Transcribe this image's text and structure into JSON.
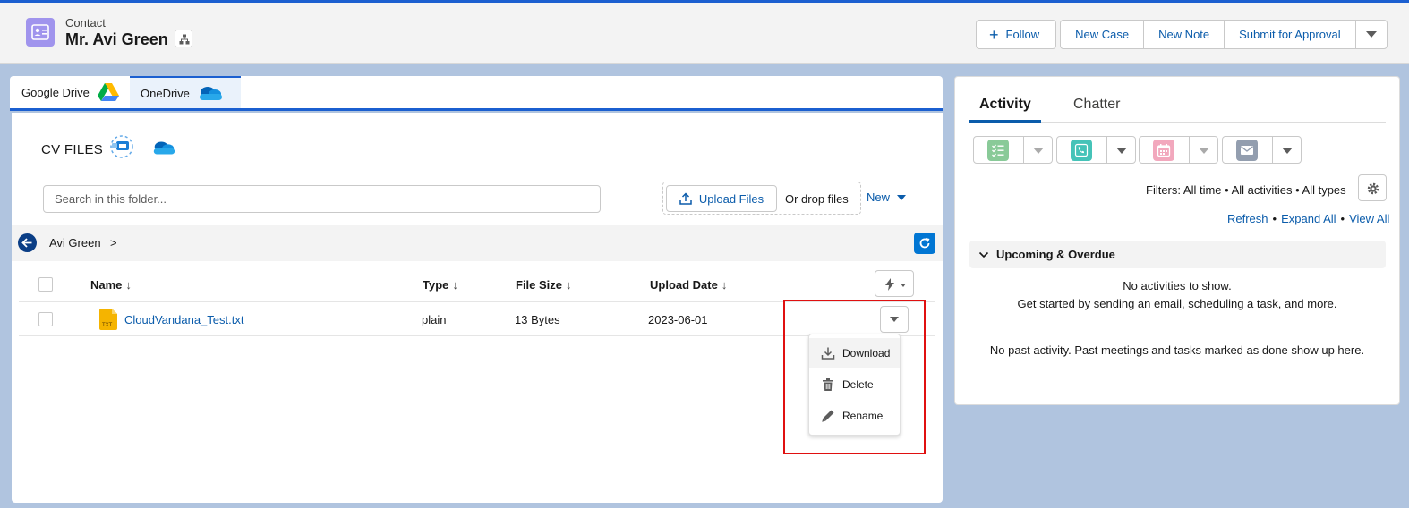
{
  "header": {
    "object_type": "Contact",
    "record_name": "Mr. Avi Green",
    "buttons": {
      "follow": "Follow",
      "new_case": "New Case",
      "new_note": "New Note",
      "submit": "Submit for Approval"
    }
  },
  "storage_tabs": [
    {
      "label": "Google Drive",
      "icon": "google-drive-icon"
    },
    {
      "label": "OneDrive",
      "icon": "onedrive-icon",
      "active": true
    }
  ],
  "files": {
    "title": "CV FILES",
    "search_placeholder": "Search in this folder...",
    "upload_label": "Upload Files",
    "drop_label": "Or drop files",
    "new_label": "New",
    "breadcrumb": {
      "folder": "Avi Green",
      "separator": ">"
    },
    "columns": {
      "name": "Name",
      "type": "Type",
      "size": "File Size",
      "date": "Upload Date",
      "sort_arrow": "↓"
    },
    "rows": [
      {
        "name": "CloudVandana_Test.txt",
        "type": "plain",
        "size": "13 Bytes",
        "date": "2023-06-01",
        "icon": "txt-file-icon"
      }
    ],
    "file_icon_label": "TXT",
    "row_menu": {
      "download": "Download",
      "delete": "Delete",
      "rename": "Rename"
    }
  },
  "activity": {
    "tabs": {
      "activity": "Activity",
      "chatter": "Chatter"
    },
    "action_colors": {
      "task": "#3ba755",
      "call": "#45c3b8",
      "event": "#eb7092",
      "email": "#939eaf"
    },
    "filters": "Filters: All time • All activities • All types",
    "links": {
      "refresh": "Refresh",
      "expand": "Expand All",
      "view": "View All",
      "dot": "•"
    },
    "section": "Upcoming & Overdue",
    "empty_line1": "No activities to show.",
    "empty_line2": "Get started by sending an email, scheduling a task, and more.",
    "past": "No past activity. Past meetings and tasks marked as done show up here."
  },
  "colors": {
    "brand": "#1b5fd0",
    "link": "#0b5cab",
    "contact_icon": "#a094ed",
    "highlight": "#e01010"
  }
}
